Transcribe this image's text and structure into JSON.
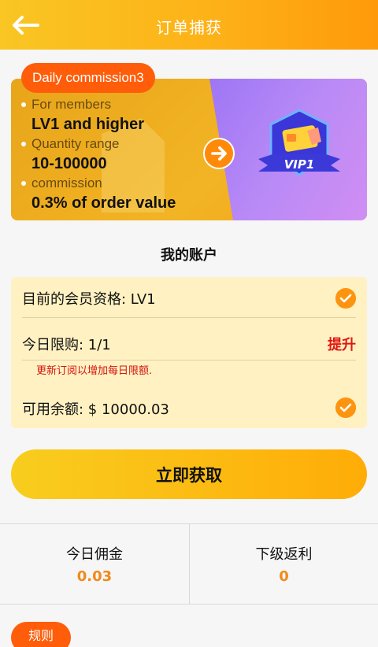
{
  "header": {
    "title": "订单捕获"
  },
  "promo": {
    "badge": "Daily commission3",
    "items": [
      {
        "label": "For members",
        "value": "LV1 and higher"
      },
      {
        "label": "Quantity range",
        "value": "10-100000"
      },
      {
        "label": "commission",
        "value": "0.3% of order value"
      }
    ],
    "vip_label": "VIP1",
    "colors": {
      "left": "#f2b424",
      "right": "#b98af6",
      "badge": "#ff5d0a"
    }
  },
  "account": {
    "title": "我的账户",
    "membership": "目前的会员资格: LV1",
    "limit": "今日限购: 1/1",
    "upgrade_label": "提升",
    "note": "更新订阅以增加每日限额.",
    "balance": "可用余额: $ 10000.03"
  },
  "cta": {
    "label": "立即获取"
  },
  "stats": [
    {
      "label": "今日佣金",
      "value": "0.03"
    },
    {
      "label": "下级返利",
      "value": "0"
    }
  ],
  "rules": {
    "label": "规则"
  },
  "colors": {
    "accent": "#ffb010",
    "value": "#f08a1a",
    "alert": "#e0170f"
  }
}
